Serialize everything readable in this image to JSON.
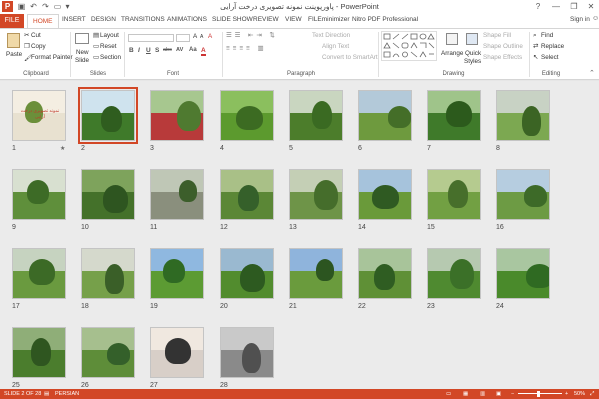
{
  "window": {
    "title": "پاورپوینت نمونه تصویری درخت آرایی - PowerPoint",
    "app_icon": "P",
    "sign_in": "Sign in",
    "help": "?",
    "minimize": "—",
    "restore": "❐",
    "close": "✕"
  },
  "quick_access": {
    "save": "▣",
    "undo": "↶",
    "redo": "↷",
    "present": "▭",
    "customize": "▾"
  },
  "tabs": [
    "FILE",
    "HOME",
    "INSERT",
    "DESIGN",
    "TRANSITIONS",
    "ANIMATIONS",
    "SLIDE SHOW",
    "REVIEW",
    "VIEW",
    "FILEminimizer",
    "Nitro PDF Professional"
  ],
  "ribbon": {
    "clipboard": {
      "label": "Clipboard",
      "paste": "Paste",
      "cut": "Cut",
      "copy": "Copy",
      "format_painter": "Format Painter"
    },
    "slides": {
      "label": "Slides",
      "new_slide_line1": "New",
      "new_slide_line2": "Slide",
      "layout": "Layout",
      "reset": "Reset",
      "section": "Section"
    },
    "font": {
      "label": "Font",
      "bold": "B",
      "italic": "I",
      "underline": "U",
      "shadow": "S",
      "strike": "abc",
      "spacing": "AV",
      "case": "Aa",
      "color": "A",
      "grow": "A",
      "shrink": "A",
      "clear": "A"
    },
    "paragraph": {
      "label": "Paragraph",
      "text_direction": "Text Direction",
      "align_text": "Align Text",
      "convert_smartart": "Convert to SmartArt"
    },
    "drawing": {
      "label": "Drawing",
      "arrange": "Arrange",
      "quick_styles_line1": "Quick",
      "quick_styles_line2": "Styles",
      "shape_fill": "Shape Fill",
      "shape_outline": "Shape Outline",
      "shape_effects": "Shape Effects"
    },
    "editing": {
      "label": "Editing",
      "find": "Find",
      "replace": "Replace",
      "select": "Select"
    }
  },
  "slides": [
    {
      "number": "1",
      "has_star": true,
      "star": "★",
      "caption": "نمونه تصویری درخت آرایی",
      "sky": "#f4eee2",
      "lawn": "#e8e1d0",
      "topiary": "#6b8f3a"
    },
    {
      "number": "2",
      "selected": true,
      "sky": "#cfe3ee",
      "lawn": "#3f7a2a",
      "topiary": "#2f5d1f"
    },
    {
      "number": "3",
      "sky": "#a7c78f",
      "lawn": "#b83a3a",
      "topiary": "#4f7a30"
    },
    {
      "number": "4",
      "sky": "#8bbf5e",
      "lawn": "#5c9a2e",
      "topiary": "#3c6b22"
    },
    {
      "number": "5",
      "sky": "#c9d6c0",
      "lawn": "#4c7d2b",
      "topiary": "#3a6a22"
    },
    {
      "number": "6",
      "sky": "#b3c9d9",
      "lawn": "#6e9a3e",
      "topiary": "#446e28"
    },
    {
      "number": "7",
      "sky": "#9fc48a",
      "lawn": "#3f7a2a",
      "topiary": "#2c5a1c"
    },
    {
      "number": "8",
      "sky": "#c8d2c4",
      "lawn": "#7ca851",
      "topiary": "#3b6424"
    },
    {
      "number": "9",
      "sky": "#d8e0d0",
      "lawn": "#5f8f3b",
      "topiary": "#3d6b26"
    },
    {
      "number": "10",
      "sky": "#7ea35c",
      "lawn": "#44712a",
      "topiary": "#2e5520"
    },
    {
      "number": "11",
      "sky": "#bfc7b6",
      "lawn": "#8a8f7d",
      "topiary": "#3c5e2b"
    },
    {
      "number": "12",
      "sky": "#a9c087",
      "lawn": "#5b8736",
      "topiary": "#35602a"
    },
    {
      "number": "13",
      "sky": "#c4cfb5",
      "lawn": "#6e9448",
      "topiary": "#456d2b"
    },
    {
      "number": "14",
      "sky": "#a6c3dc",
      "lawn": "#6a9a3a",
      "topiary": "#2f5a22"
    },
    {
      "number": "15",
      "sky": "#b5cb8f",
      "lawn": "#72a043",
      "topiary": "#476f2b"
    },
    {
      "number": "16",
      "sky": "#b6cde0",
      "lawn": "#6d9b44",
      "topiary": "#3d6a28"
    },
    {
      "number": "17",
      "sky": "#c6d3c0",
      "lawn": "#6a9a3f",
      "topiary": "#3c6a26"
    },
    {
      "number": "18",
      "sky": "#d5d9cc",
      "lawn": "#76a04a",
      "topiary": "#3a5f28"
    },
    {
      "number": "19",
      "sky": "#8fb8e0",
      "lawn": "#5c9b33",
      "topiary": "#2f6a23"
    },
    {
      "number": "20",
      "sky": "#9ab9d0",
      "lawn": "#528c2e",
      "topiary": "#2d5a20"
    },
    {
      "number": "21",
      "sky": "#8fb4dc",
      "lawn": "#6a9b3d",
      "topiary": "#2c5520"
    },
    {
      "number": "22",
      "sky": "#a8c49a",
      "lawn": "#5f9036",
      "topiary": "#2f5d22"
    },
    {
      "number": "23",
      "sky": "#b6c9b0",
      "lawn": "#4f8a30",
      "topiary": "#3b7028"
    },
    {
      "number": "24",
      "sky": "#a9c6a0",
      "lawn": "#4a8a2b",
      "topiary": "#2f6a22"
    },
    {
      "number": "25",
      "sky": "#8fae78",
      "lawn": "#4b7d2d",
      "topiary": "#2f5620"
    },
    {
      "number": "26",
      "sky": "#a6bf8e",
      "lawn": "#5e8d39",
      "topiary": "#34602a"
    },
    {
      "number": "27",
      "sky": "#f0e8e0",
      "lawn": "#d8cfc8",
      "topiary": "#333333"
    },
    {
      "number": "28",
      "sky": "#c9c9c9",
      "lawn": "#8a8a8a",
      "topiary": "#505050"
    }
  ],
  "status": {
    "slide_info": "SLIDE 2 OF 28",
    "language": "PERSIAN",
    "zoom_minus": "−",
    "zoom_plus": "+",
    "zoom_level": "50%"
  },
  "colors": {
    "accent": "#d24726",
    "selection": "#d24726",
    "background": "#ebebeb"
  }
}
